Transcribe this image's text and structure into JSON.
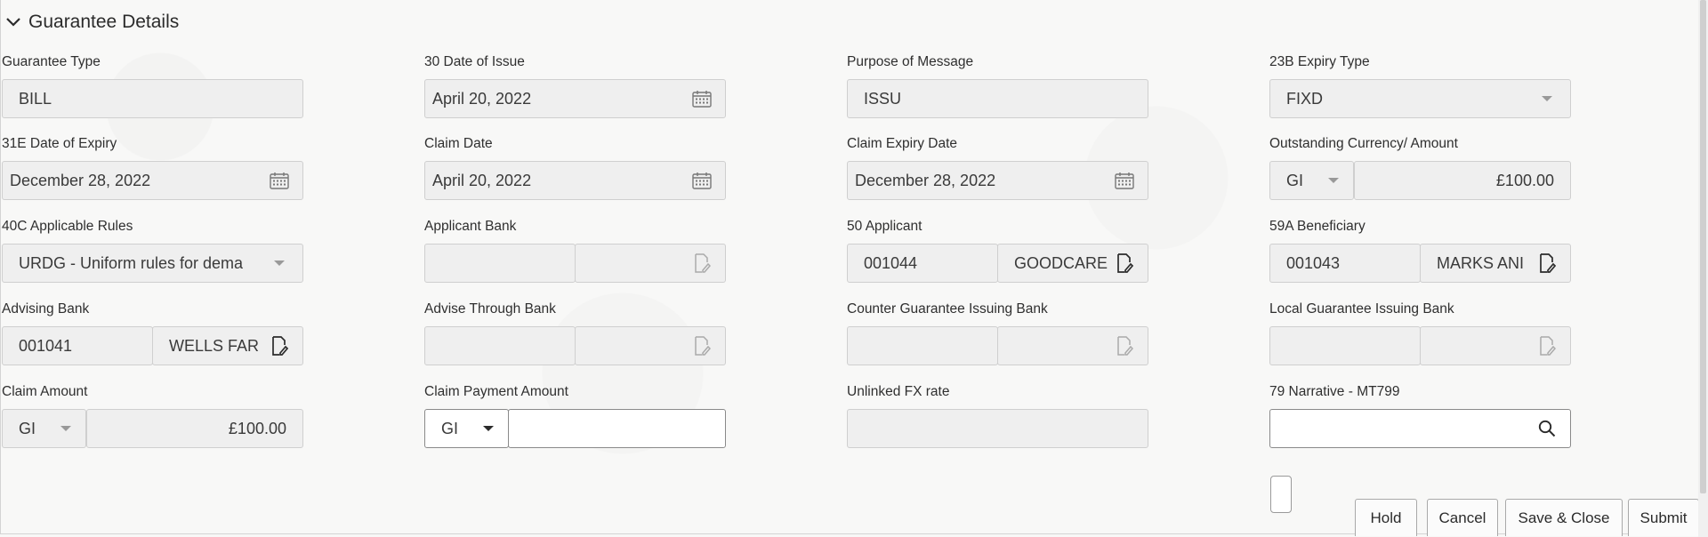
{
  "section": {
    "title": "Guarantee Details"
  },
  "fields": {
    "guarantee_type": {
      "label": "Guarantee Type",
      "value": "BILL"
    },
    "date_of_issue": {
      "label": "30 Date of Issue",
      "value": "April 20, 2022"
    },
    "purpose_of_message": {
      "label": "Purpose of Message",
      "value": "ISSU"
    },
    "expiry_type": {
      "label": "23B Expiry Type",
      "value": "FIXD"
    },
    "date_of_expiry": {
      "label": "31E Date of Expiry",
      "value": "December 28, 2022"
    },
    "claim_date": {
      "label": "Claim Date",
      "value": "April 20, 2022"
    },
    "claim_expiry_date": {
      "label": "Claim Expiry Date",
      "value": "December 28, 2022"
    },
    "outstanding": {
      "label": "Outstanding Currency/ Amount",
      "currency": "GI",
      "amount": "£100.00"
    },
    "applicable_rules": {
      "label": "40C Applicable Rules",
      "value": "URDG - Uniform rules for dema"
    },
    "applicant_bank": {
      "label": "Applicant Bank",
      "id": "",
      "name": ""
    },
    "applicant": {
      "label": "50 Applicant",
      "id": "001044",
      "name": "GOODCARE"
    },
    "beneficiary": {
      "label": "59A Beneficiary",
      "id": "001043",
      "name": "MARKS ANI"
    },
    "advising_bank": {
      "label": "Advising Bank",
      "id": "001041",
      "name": "WELLS FAR"
    },
    "advise_through_bank": {
      "label": "Advise Through Bank",
      "id": "",
      "name": ""
    },
    "counter_guarantee_bank": {
      "label": "Counter Guarantee Issuing Bank",
      "id": "",
      "name": ""
    },
    "local_guarantee_bank": {
      "label": "Local Guarantee Issuing Bank",
      "id": "",
      "name": ""
    },
    "claim_amount": {
      "label": "Claim Amount",
      "currency": "GI",
      "amount": "£100.00"
    },
    "claim_payment_amount": {
      "label": "Claim Payment Amount",
      "currency": "GI",
      "amount": ""
    },
    "unlinked_fx_rate": {
      "label": "Unlinked FX rate",
      "value": ""
    },
    "narrative": {
      "label": "79 Narrative - MT799",
      "value": ""
    }
  },
  "buttons": {
    "hold": "Hold",
    "cancel": "Cancel",
    "save_close": "Save & Close",
    "submit": "Submit"
  },
  "colors": {
    "field_bg": "#efefef",
    "border": "#cfcfcf",
    "text": "#2b2b2b"
  }
}
